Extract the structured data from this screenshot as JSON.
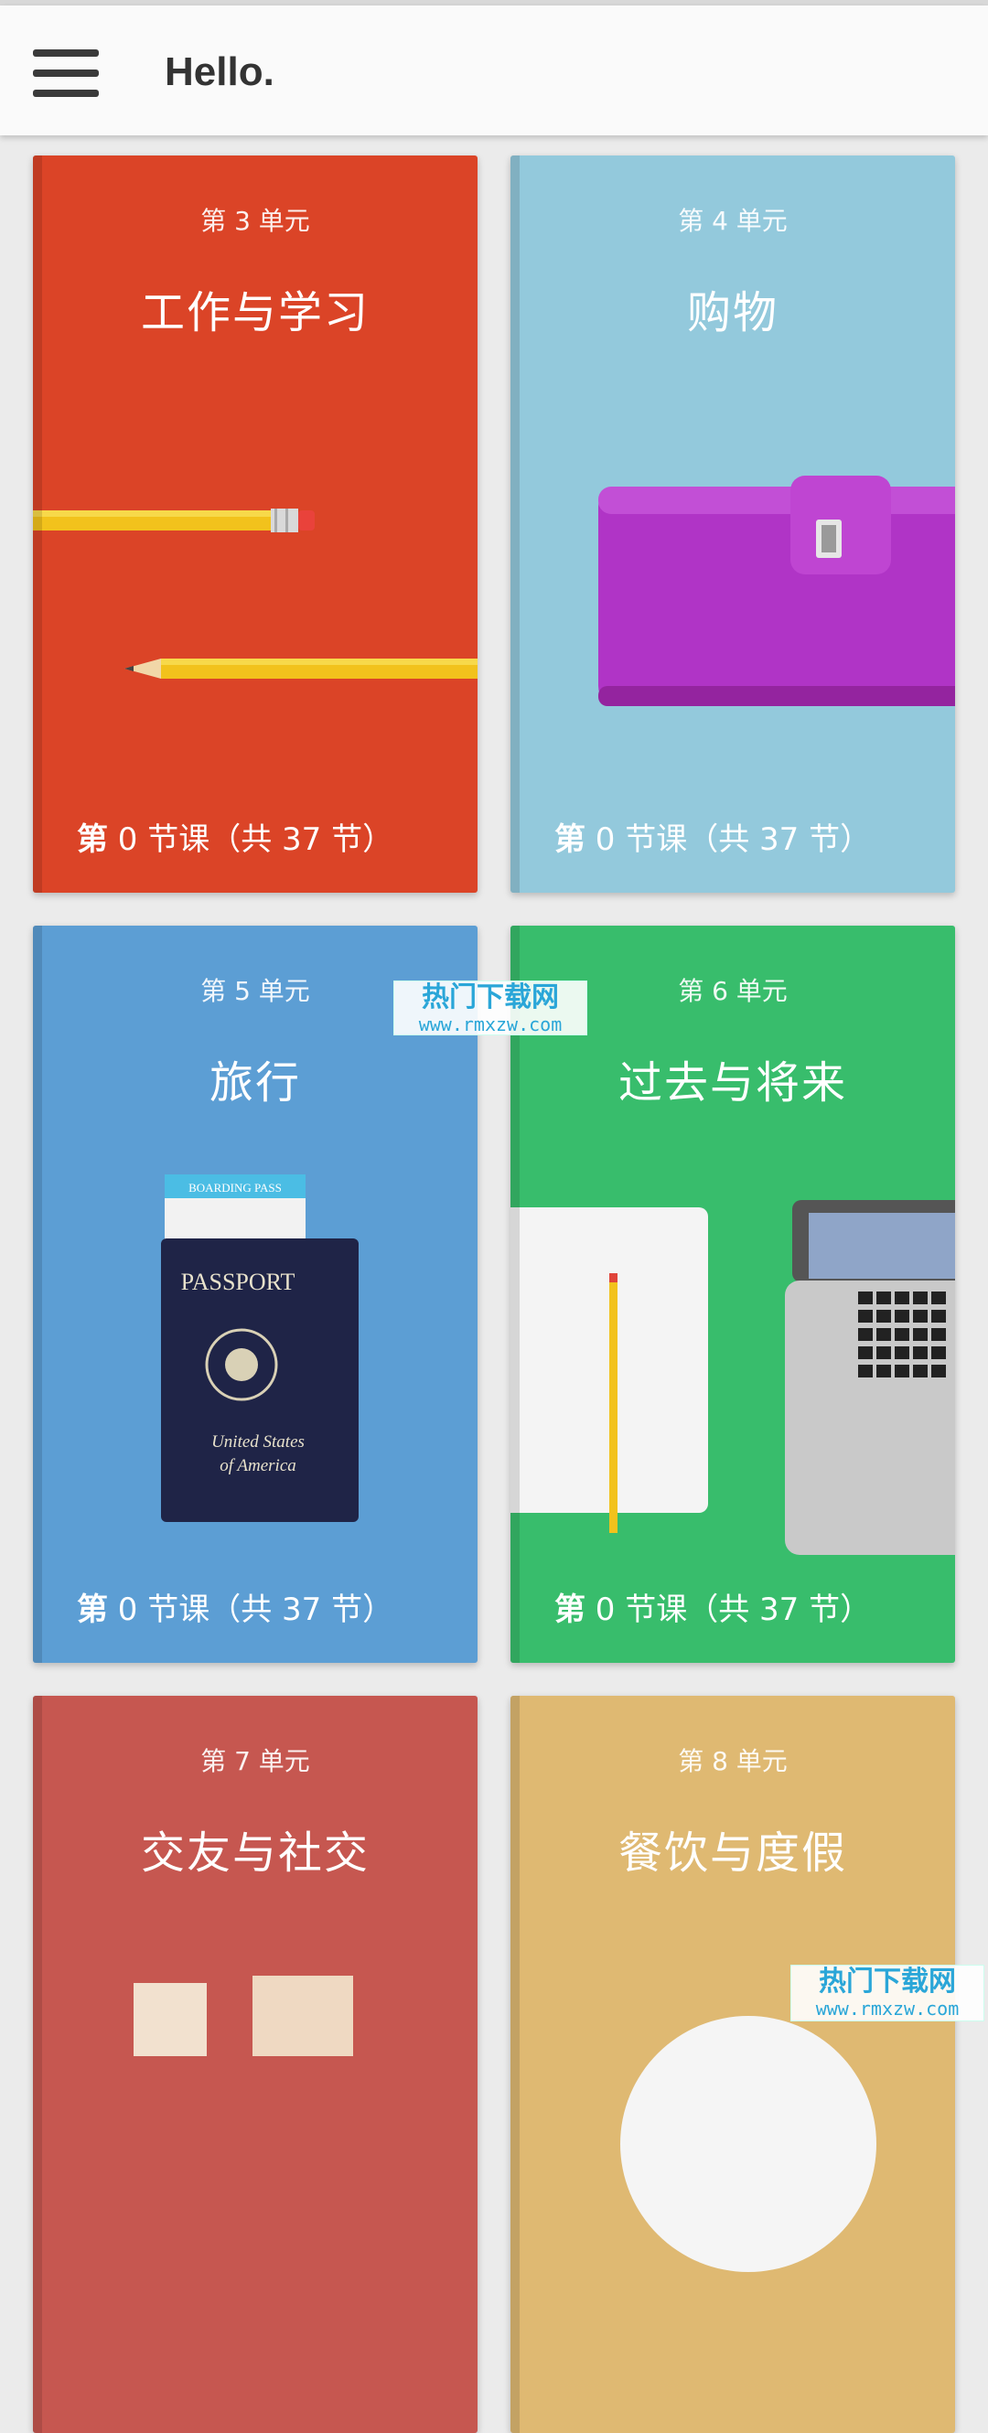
{
  "app_bar": {
    "title": "Hello.",
    "menu_icon": "hamburger-menu-icon"
  },
  "units": [
    {
      "unit_label": "第 3 单元",
      "title": "工作与学习",
      "progress_prefix": "第",
      "progress_rest": " 0 节课（共 37 节）",
      "color": "#db4427",
      "art": "pencils"
    },
    {
      "unit_label": "第 4 单元",
      "title": "购物",
      "progress_prefix": "第",
      "progress_rest": " 0 节课（共 37 节）",
      "color": "#93c9dc",
      "art": "wallet"
    },
    {
      "unit_label": "第 5 单元",
      "title": "旅行",
      "progress_prefix": "第",
      "progress_rest": " 0 节课（共 37 节）",
      "color": "#5c9ed4",
      "art": "passport",
      "boarding_pass_text": "BOARDING PASS",
      "passport_text": "PASSPORT",
      "passport_country_line1": "United States",
      "passport_country_line2": "of America"
    },
    {
      "unit_label": "第 6 单元",
      "title": "过去与将来",
      "progress_prefix": "第",
      "progress_rest": " 0 节课（共 37 节）",
      "color": "#38bd6c",
      "art": "notebook-laptop"
    },
    {
      "unit_label": "第 7 单元",
      "title": "交友与社交",
      "color": "#c65750",
      "art": "blocks"
    },
    {
      "unit_label": "第 8 单元",
      "title": "餐饮与度假",
      "color": "#dfb972",
      "art": "plate"
    }
  ],
  "watermarks": [
    {
      "main": "热门下载网",
      "sub": "www.rmxzw.com"
    },
    {
      "main": "热门下载网",
      "sub": "www.rmxzw.com"
    }
  ]
}
